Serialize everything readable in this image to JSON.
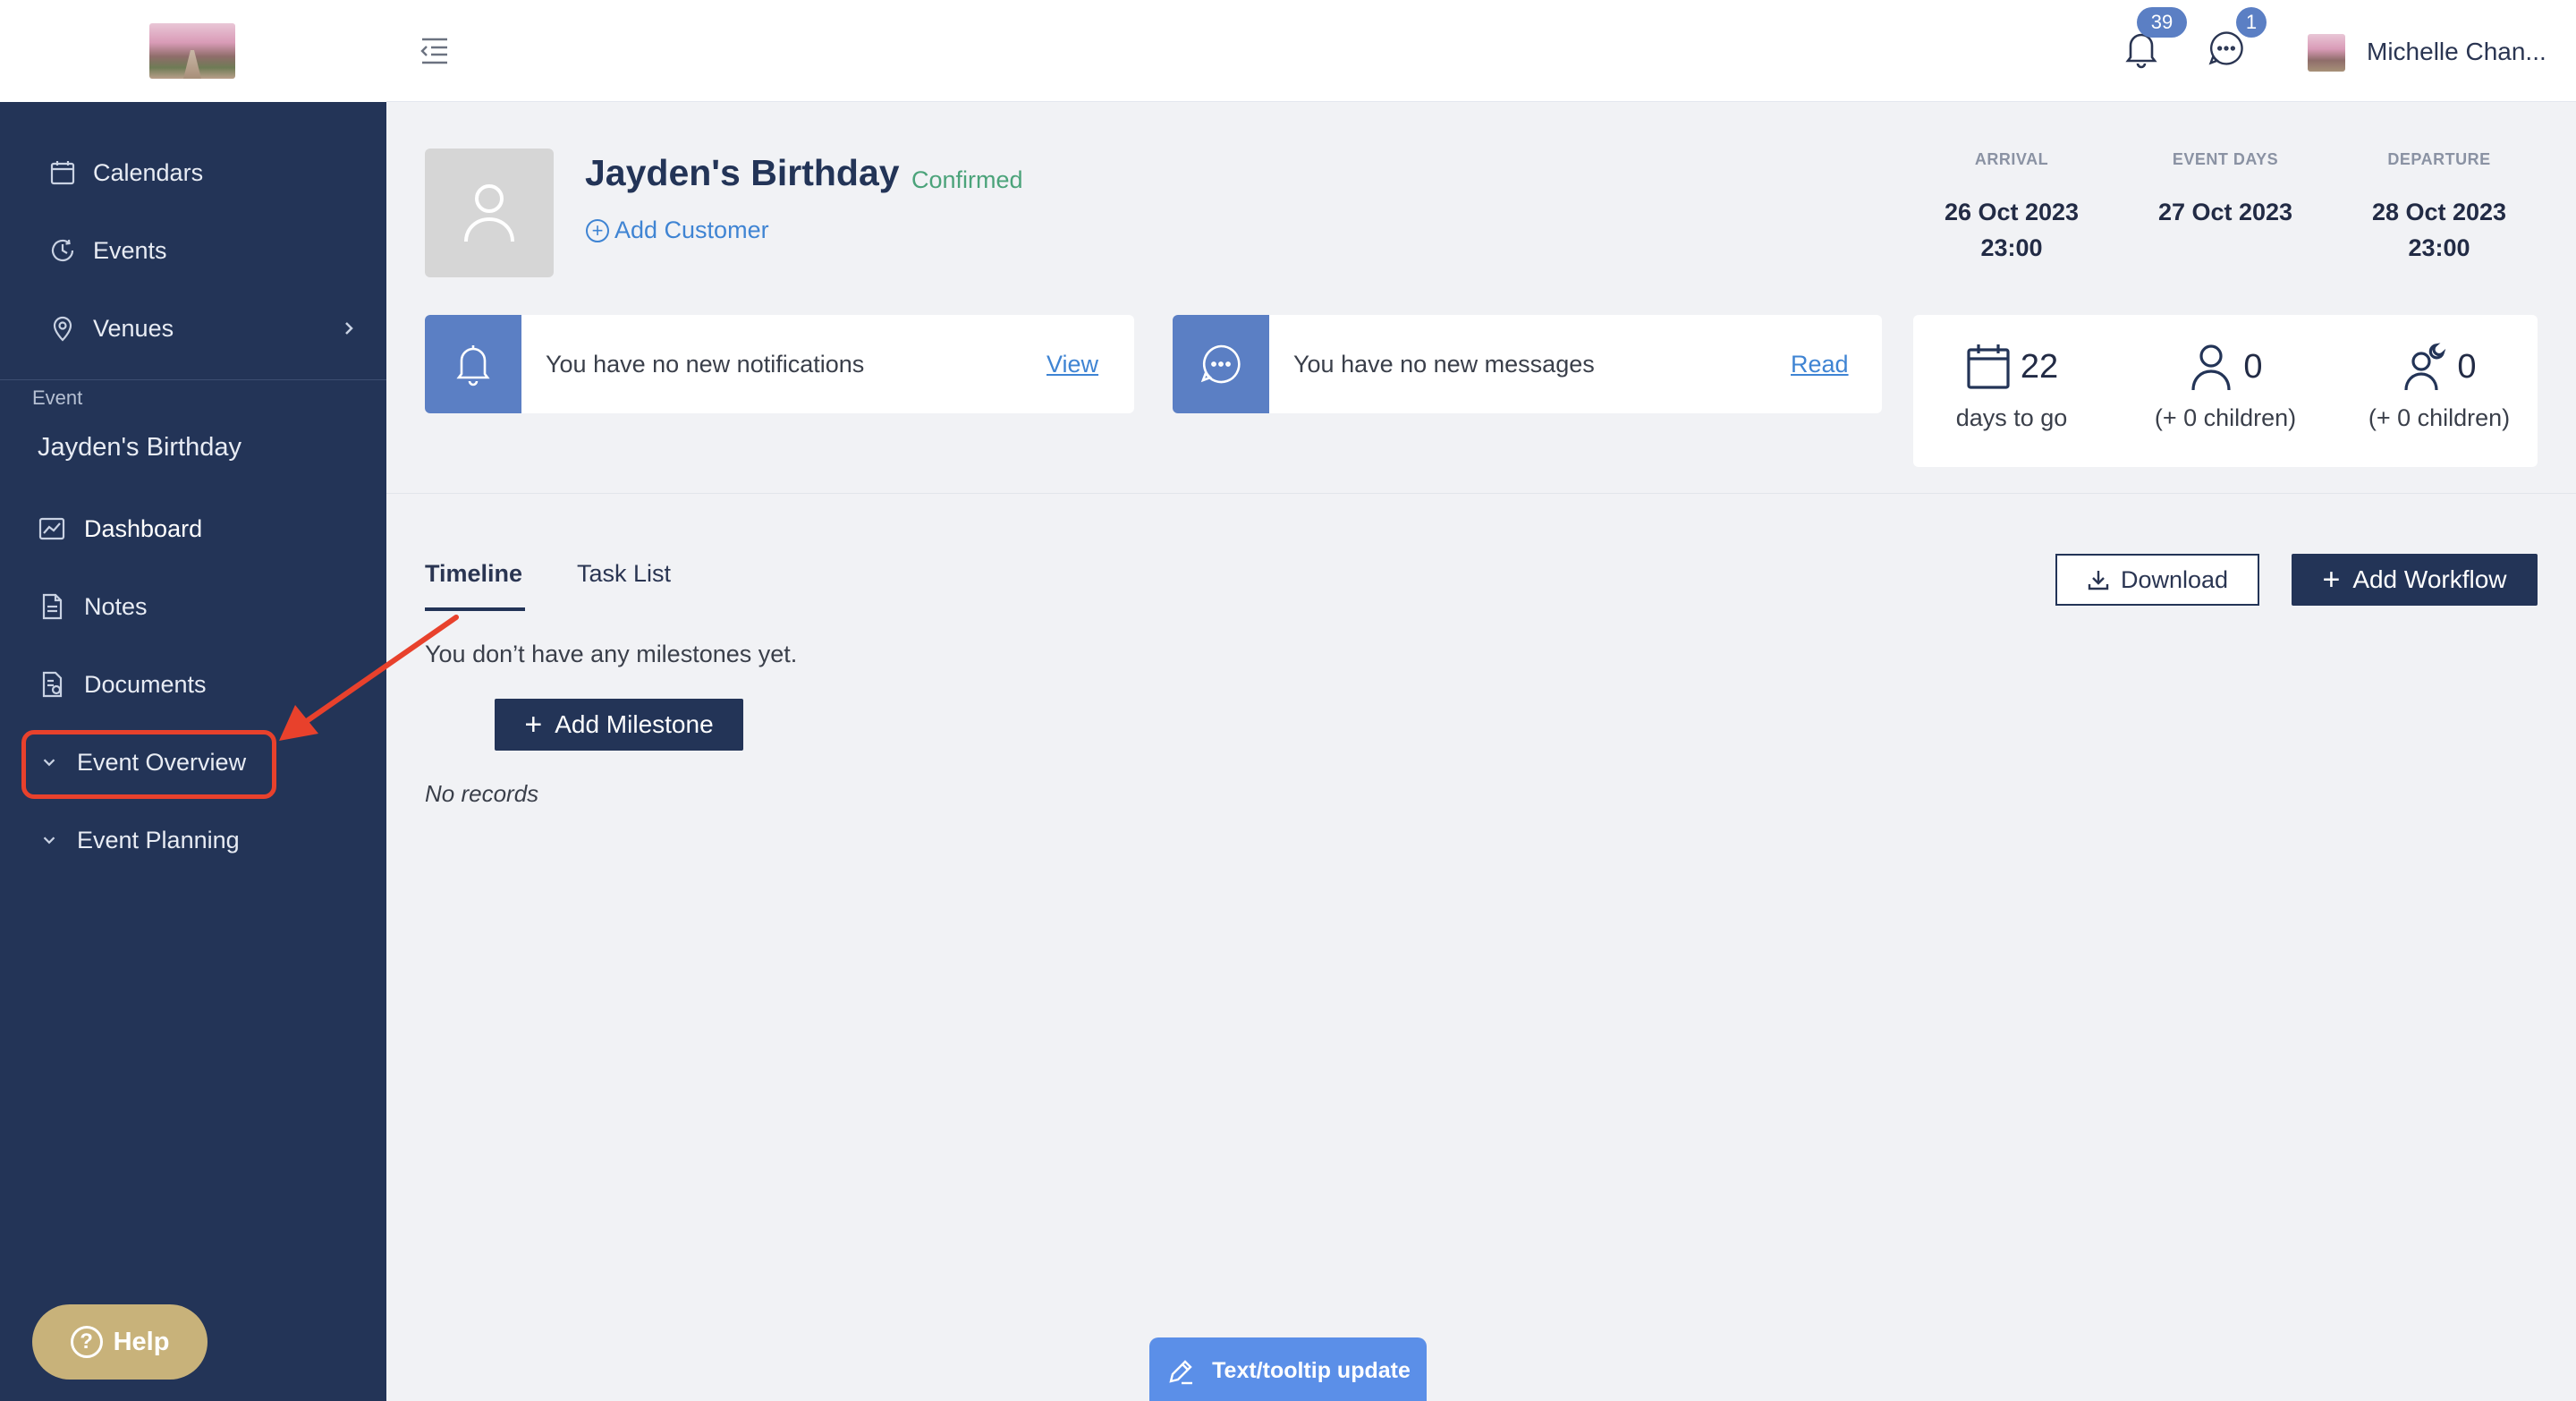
{
  "topbar": {
    "notification_count": "39",
    "message_count": "1",
    "user_name": "Michelle Chan..."
  },
  "sidebar": {
    "items": [
      {
        "label": "Calendars",
        "icon": "calendar-icon"
      },
      {
        "label": "Events",
        "icon": "clock-icon"
      },
      {
        "label": "Venues",
        "icon": "location-pin-icon"
      }
    ],
    "section_label": "Event",
    "event_name": "Jayden's Birthday",
    "event_items": [
      {
        "label": "Dashboard",
        "icon": "chart-icon"
      },
      {
        "label": "Notes",
        "icon": "note-icon"
      },
      {
        "label": "Documents",
        "icon": "document-icon"
      }
    ],
    "groups": [
      {
        "label": "Event Overview"
      },
      {
        "label": "Event Planning"
      }
    ],
    "help_label": "Help"
  },
  "event": {
    "title": "Jayden's Birthday",
    "status": "Confirmed",
    "add_customer": "Add Customer"
  },
  "dates": {
    "arrival_header": "ARRIVAL",
    "arrival_date": "26 Oct 2023",
    "arrival_time": "23:00",
    "event_days_header": "EVENT DAYS",
    "event_days_value": "27 Oct 2023",
    "departure_header": "DEPARTURE",
    "departure_date": "28 Oct 2023",
    "departure_time": "23:00"
  },
  "notifications": {
    "text": "You have no new notifications",
    "link": "View"
  },
  "messages": {
    "text": "You have no new messages",
    "link": "Read"
  },
  "stats": {
    "days_value": "22",
    "days_label": "days to go",
    "adults_value": "0",
    "adults_label": "(+ 0 children)",
    "overnight_value": "0",
    "overnight_label": "(+ 0 children)"
  },
  "tabs": [
    {
      "label": "Timeline"
    },
    {
      "label": "Task List"
    }
  ],
  "actions": {
    "download": "Download",
    "add_workflow": "Add Workflow",
    "add_milestone": "Add Milestone"
  },
  "timeline": {
    "empty_text": "You don’t have any milestones yet.",
    "no_records": "No records"
  },
  "tooltip_update": "Text/tooltip update",
  "colors": {
    "sidebar": "#233457",
    "accent": "#5b7fc4",
    "link": "#3f84d3",
    "status_confirmed": "#4ba37a",
    "highlight": "#e8412c",
    "help": "#c8b27a"
  }
}
